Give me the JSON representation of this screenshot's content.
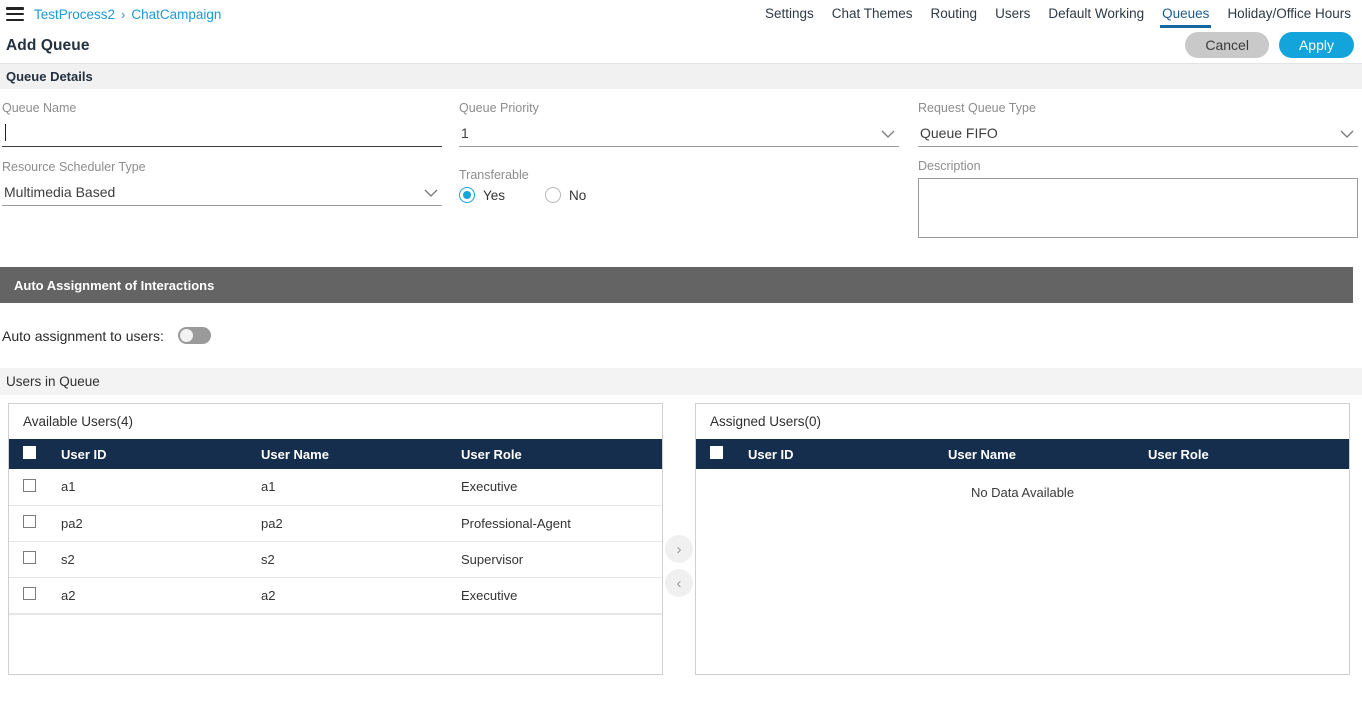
{
  "topbar": {
    "menu_icon": "hamburger-icon",
    "breadcrumb": {
      "root": "TestProcess2",
      "separator": "›",
      "current": "ChatCampaign"
    },
    "tabs": [
      {
        "label": "Settings",
        "active": false
      },
      {
        "label": "Chat Themes",
        "active": false
      },
      {
        "label": "Routing",
        "active": false
      },
      {
        "label": "Users",
        "active": false
      },
      {
        "label": "Default Working",
        "active": false
      },
      {
        "label": "Queues",
        "active": true
      },
      {
        "label": "Holiday/Office Hours",
        "active": false
      }
    ],
    "active_tab_underline_color": "#1565a0",
    "link_color": "#1c9ad6"
  },
  "page": {
    "title": "Add Queue",
    "cancel_label": "Cancel",
    "apply_label": "Apply",
    "cancel_color": "#c9c9c9",
    "apply_color": "#13a4dc"
  },
  "queue_details": {
    "section_title": "Queue Details",
    "queue_name": {
      "label": "Queue Name",
      "value": "",
      "placeholder": ""
    },
    "resource_scheduler_type": {
      "label": "Resource Scheduler Type",
      "value": "Multimedia Based"
    },
    "queue_priority": {
      "label": "Queue Priority",
      "value": "1"
    },
    "transferable": {
      "label": "Transferable",
      "selected": "Yes",
      "options": [
        {
          "label": "Yes",
          "checked": true
        },
        {
          "label": "No",
          "checked": false
        }
      ]
    },
    "request_queue_type": {
      "label": "Request Queue Type",
      "value": "Queue FIFO"
    },
    "description": {
      "label": "Description",
      "value": "",
      "placeholder": ""
    }
  },
  "auto_assignment": {
    "section_title": "Auto Assignment of Interactions",
    "section_bg": "#646464",
    "toggle_label": "Auto assignment to users:",
    "toggle_on": false
  },
  "users_in_queue": {
    "section_title": "Users in Queue",
    "available": {
      "title": "Available Users(4)",
      "columns": [
        "User ID",
        "User Name",
        "User Role"
      ],
      "rows": [
        {
          "checked": false,
          "user_id": "a1",
          "user_name": "a1",
          "user_role": "Executive"
        },
        {
          "checked": false,
          "user_id": "pa2",
          "user_name": "pa2",
          "user_role": "Professional-Agent"
        },
        {
          "checked": false,
          "user_id": "s2",
          "user_name": "s2",
          "user_role": "Supervisor"
        },
        {
          "checked": false,
          "user_id": "a2",
          "user_name": "a2",
          "user_role": "Executive"
        }
      ]
    },
    "assigned": {
      "title": "Assigned Users(0)",
      "columns": [
        "User ID",
        "User Name",
        "User Role"
      ],
      "rows": [],
      "empty_message": "No Data Available"
    },
    "transfer": {
      "move_right_icon": "chevron-right-icon",
      "move_left_icon": "chevron-left-icon",
      "move_right_glyph": "›",
      "move_left_glyph": "‹"
    },
    "header_bg": "#152e4d"
  }
}
